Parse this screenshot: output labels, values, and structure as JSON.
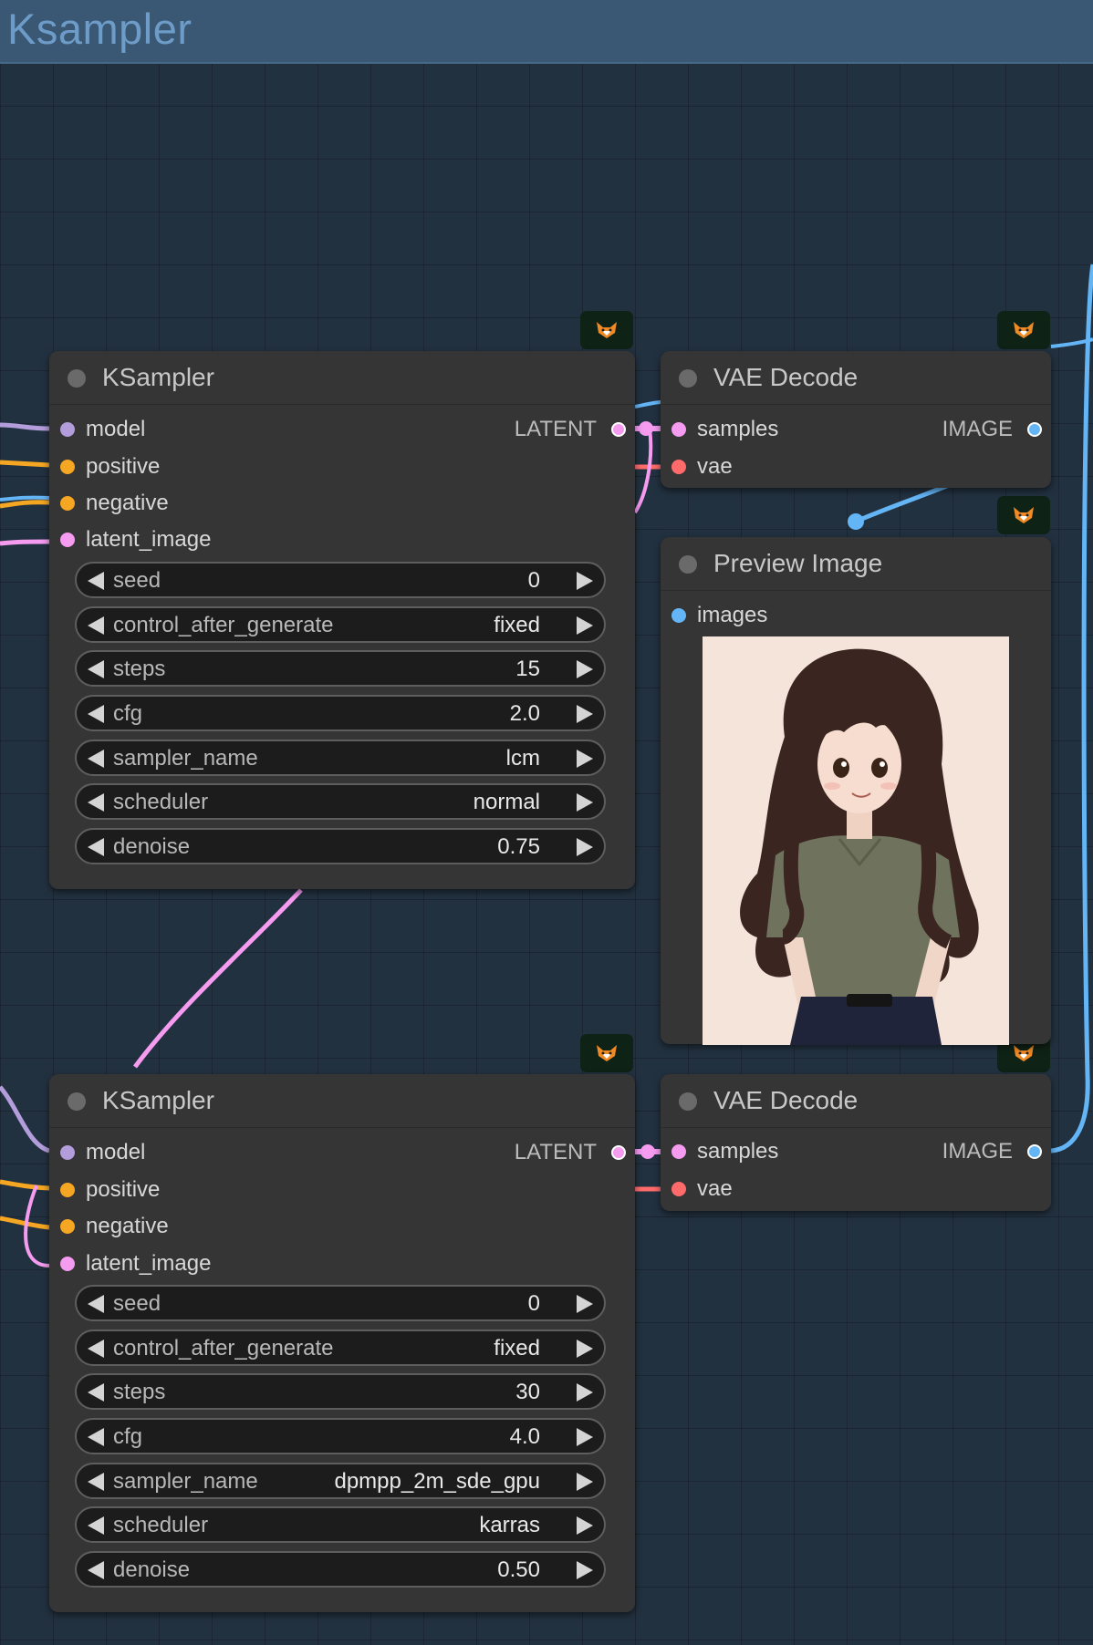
{
  "group": {
    "title": "Ksampler"
  },
  "colors": {
    "model": "#b39ddb",
    "positive": "#f5a623",
    "negative": "#f5a623",
    "latent": "#f59bf0",
    "vae": "#ff6b6b",
    "image": "#64b5f6"
  },
  "icons": {
    "node_badge": "fox-icon"
  },
  "ksampler1": {
    "title": "KSampler",
    "inputs": [
      "model",
      "positive",
      "negative",
      "latent_image"
    ],
    "output": "LATENT",
    "widgets": [
      {
        "name": "seed",
        "value": "0"
      },
      {
        "name": "control_after_generate",
        "value": "fixed"
      },
      {
        "name": "steps",
        "value": "15"
      },
      {
        "name": "cfg",
        "value": "2.0"
      },
      {
        "name": "sampler_name",
        "value": "lcm"
      },
      {
        "name": "scheduler",
        "value": "normal"
      },
      {
        "name": "denoise",
        "value": "0.75"
      }
    ]
  },
  "vae1": {
    "title": "VAE Decode",
    "inputs": [
      "samples",
      "vae"
    ],
    "output": "IMAGE"
  },
  "preview": {
    "title": "Preview Image",
    "inputs": [
      "images"
    ]
  },
  "ksampler2": {
    "title": "KSampler",
    "inputs": [
      "model",
      "positive",
      "negative",
      "latent_image"
    ],
    "output": "LATENT",
    "widgets": [
      {
        "name": "seed",
        "value": "0"
      },
      {
        "name": "control_after_generate",
        "value": "fixed"
      },
      {
        "name": "steps",
        "value": "30"
      },
      {
        "name": "cfg",
        "value": "4.0"
      },
      {
        "name": "sampler_name",
        "value": "dpmpp_2m_sde_gpu"
      },
      {
        "name": "scheduler",
        "value": "karras"
      },
      {
        "name": "denoise",
        "value": "0.50"
      }
    ]
  },
  "vae2": {
    "title": "VAE Decode",
    "inputs": [
      "samples",
      "vae"
    ],
    "output": "IMAGE"
  }
}
